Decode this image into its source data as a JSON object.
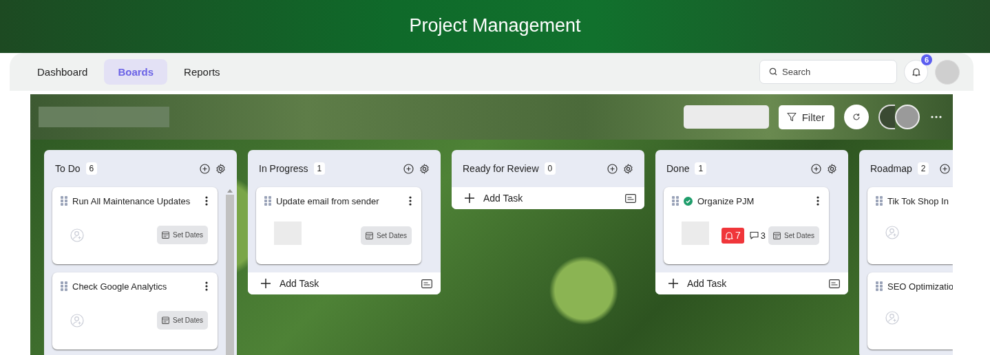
{
  "app_title": "Project Management",
  "nav_tabs": [
    {
      "label": "Dashboard",
      "selected": false
    },
    {
      "label": "Boards",
      "selected": true
    },
    {
      "label": "Reports",
      "selected": false
    }
  ],
  "search": {
    "placeholder": "Search"
  },
  "notifications": {
    "count": "6"
  },
  "board_toolbar": {
    "filter_label": "Filter"
  },
  "columns": [
    {
      "title": "To Do",
      "count": "6",
      "scrollable": true,
      "tasks": [
        {
          "title": "Run All Maintenance Updates",
          "assignee": {
            "kind": "empty"
          },
          "completed": false,
          "dates_label": "Set Dates"
        },
        {
          "title": "Check Google Analytics",
          "assignee": {
            "kind": "empty"
          },
          "completed": false,
          "dates_label": "Set Dates"
        }
      ]
    },
    {
      "title": "In Progress",
      "count": "1",
      "scrollable": false,
      "add_task": "Add Task",
      "tasks": [
        {
          "title": "Update email from sender",
          "assignee": {
            "kind": "blurred"
          },
          "completed": false,
          "dates_label": "Set Dates"
        }
      ]
    },
    {
      "title": "Ready for Review",
      "count": "0",
      "scrollable": false,
      "add_task": "Add Task"
    },
    {
      "title": "Done",
      "count": "1",
      "scrollable": false,
      "add_task": "Add Task",
      "tasks": [
        {
          "title": "Organize PJM",
          "assignee": {
            "kind": "blurred"
          },
          "completed": true,
          "alerts": "7",
          "comments": "3",
          "dates_label": "Set Dates"
        }
      ]
    },
    {
      "title": "Roadmap",
      "count": "2",
      "scrollable": false,
      "tasks": [
        {
          "title": "Tik Tok Shop In",
          "assignee": {
            "kind": "empty"
          },
          "completed": false
        },
        {
          "title": "SEO Optimizatio",
          "assignee": {
            "kind": "empty"
          },
          "completed": false
        }
      ]
    }
  ]
}
